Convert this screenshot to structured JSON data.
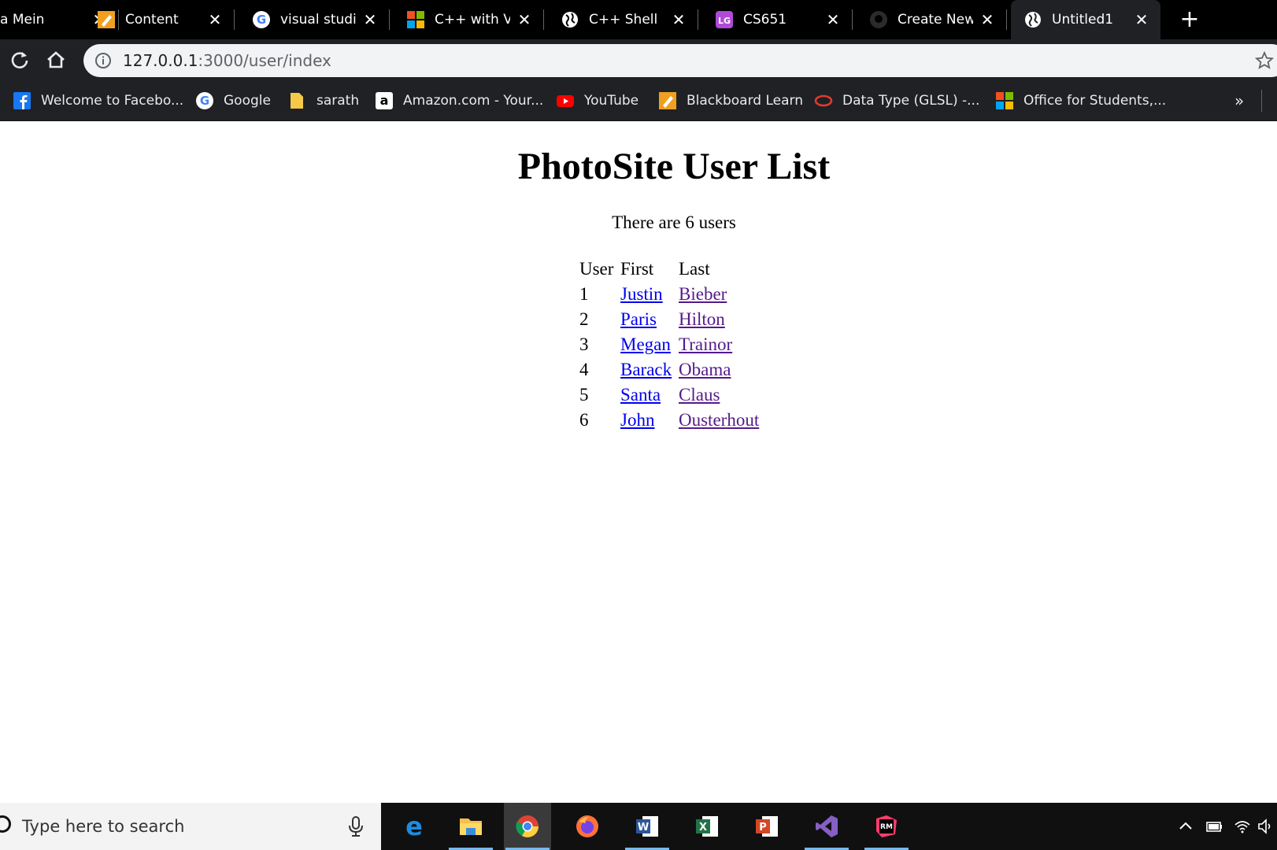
{
  "browser": {
    "tabs": [
      {
        "title": "a Mein",
        "icon": "edge-text-icon"
      },
      {
        "title": "Content",
        "icon": "pencil-icon"
      },
      {
        "title": "visual studio",
        "icon": "google-icon"
      },
      {
        "title": "C++ with Vis",
        "icon": "microsoft-icon"
      },
      {
        "title": "C++ Shell",
        "icon": "globe-icon"
      },
      {
        "title": "CS651",
        "icon": "lg-icon"
      },
      {
        "title": "Create New",
        "icon": "github-icon"
      },
      {
        "title": "Untitled1",
        "icon": "globe-icon",
        "active": true
      }
    ],
    "close_glyph": "✕",
    "new_tab_glyph": "+",
    "address": {
      "host": "127.0.0.1",
      "path": ":3000/user/index"
    },
    "bookmarks": [
      {
        "label": "Welcome to Facebo...",
        "icon": "facebook-icon"
      },
      {
        "label": "Google",
        "icon": "google-icon"
      },
      {
        "label": "sarath",
        "icon": "folder-icon"
      },
      {
        "label": "Amazon.com - Your...",
        "icon": "amazon-icon"
      },
      {
        "label": "YouTube",
        "icon": "youtube-icon"
      },
      {
        "label": "Blackboard Learn",
        "icon": "pencil-icon"
      },
      {
        "label": "Data Type (GLSL) -...",
        "icon": "oracle-icon"
      },
      {
        "label": "Office for Students,...",
        "icon": "microsoft-icon"
      }
    ],
    "bookmarks_more": "»"
  },
  "page": {
    "title": "PhotoSite User List",
    "count_text": "There are 6 users",
    "headers": {
      "user": "User",
      "first": "First",
      "last": "Last"
    },
    "users": [
      {
        "id": "1",
        "first": "Justin",
        "last": "Bieber"
      },
      {
        "id": "2",
        "first": "Paris",
        "last": "Hilton"
      },
      {
        "id": "3",
        "first": "Megan",
        "last": "Trainor"
      },
      {
        "id": "4",
        "first": "Barack",
        "last": "Obama"
      },
      {
        "id": "5",
        "first": "Santa",
        "last": "Claus"
      },
      {
        "id": "6",
        "first": "John",
        "last": "Ousterhout"
      }
    ]
  },
  "taskbar": {
    "search_placeholder": "Type here to search",
    "apps": [
      "edge-icon",
      "file-explorer-icon",
      "chrome-icon",
      "firefox-icon",
      "word-icon",
      "excel-icon",
      "powerpoint-icon",
      "visual-studio-icon",
      "rubymine-icon"
    ],
    "active_app": "chrome-icon"
  },
  "colors": {
    "link": "#0000ee",
    "visited_link": "#551a8b",
    "toolbar": "#202124",
    "taskbar": "#101010"
  }
}
